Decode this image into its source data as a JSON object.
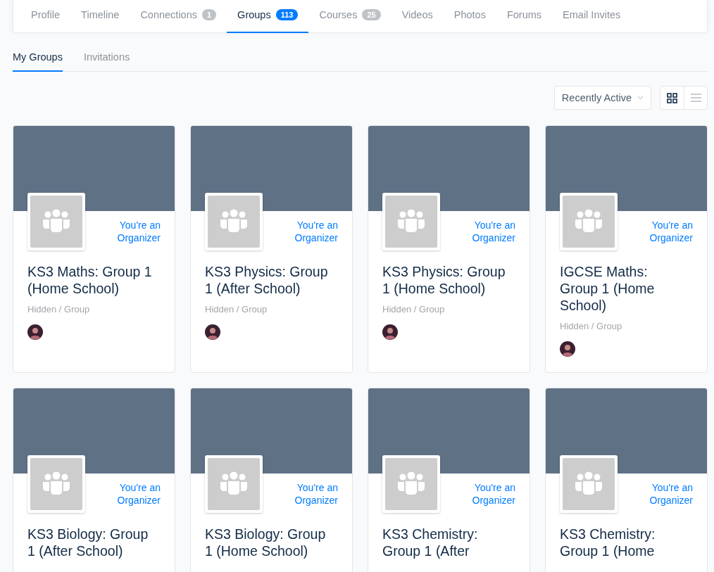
{
  "profile_tabs": [
    {
      "label": "Profile",
      "selected": false
    },
    {
      "label": "Timeline",
      "selected": false
    },
    {
      "label": "Connections",
      "count": "1",
      "selected": false
    },
    {
      "label": "Groups",
      "count": "113",
      "selected": true
    },
    {
      "label": "Courses",
      "count": "25",
      "selected": false
    },
    {
      "label": "Videos",
      "selected": false
    },
    {
      "label": "Photos",
      "selected": false
    },
    {
      "label": "Forums",
      "selected": false
    },
    {
      "label": "Email Invites",
      "selected": false
    }
  ],
  "sub_tabs": [
    {
      "label": "My Groups",
      "selected": true
    },
    {
      "label": "Invitations",
      "selected": false
    }
  ],
  "sort": {
    "value": "Recently Active"
  },
  "view_toggle": [
    {
      "kind": "grid",
      "selected": true
    },
    {
      "kind": "list",
      "selected": false
    }
  ],
  "groups": [
    {
      "title": "KS3 Maths: Group 1 (Home School)",
      "role": "You're an Organizer",
      "meta": "Hidden / Group",
      "avatar": true
    },
    {
      "title": "KS3 Physics: Group 1 (After School)",
      "role": "You're an Organizer",
      "meta": "Hidden / Group",
      "avatar": true
    },
    {
      "title": "KS3 Physics: Group 1 (Home School)",
      "role": "You're an Organizer",
      "meta": "Hidden / Group",
      "avatar": true
    },
    {
      "title": "IGCSE Maths: Group 1 (Home School)",
      "role": "You're an Organizer",
      "meta": "Hidden / Group",
      "avatar": true
    },
    {
      "title": "KS3 Biology: Group 1 (After School)",
      "role": "You're an Organizer",
      "avatar": false
    },
    {
      "title": "KS3 Biology: Group 1 (Home School)",
      "role": "You're an Organizer",
      "avatar": false
    },
    {
      "title": "KS3 Chemistry: Group 1 (After",
      "role": "You're an Organizer",
      "avatar": false
    },
    {
      "title": "KS3 Chemistry: Group 1 (Home",
      "role": "You're an Organizer",
      "avatar": false
    }
  ]
}
